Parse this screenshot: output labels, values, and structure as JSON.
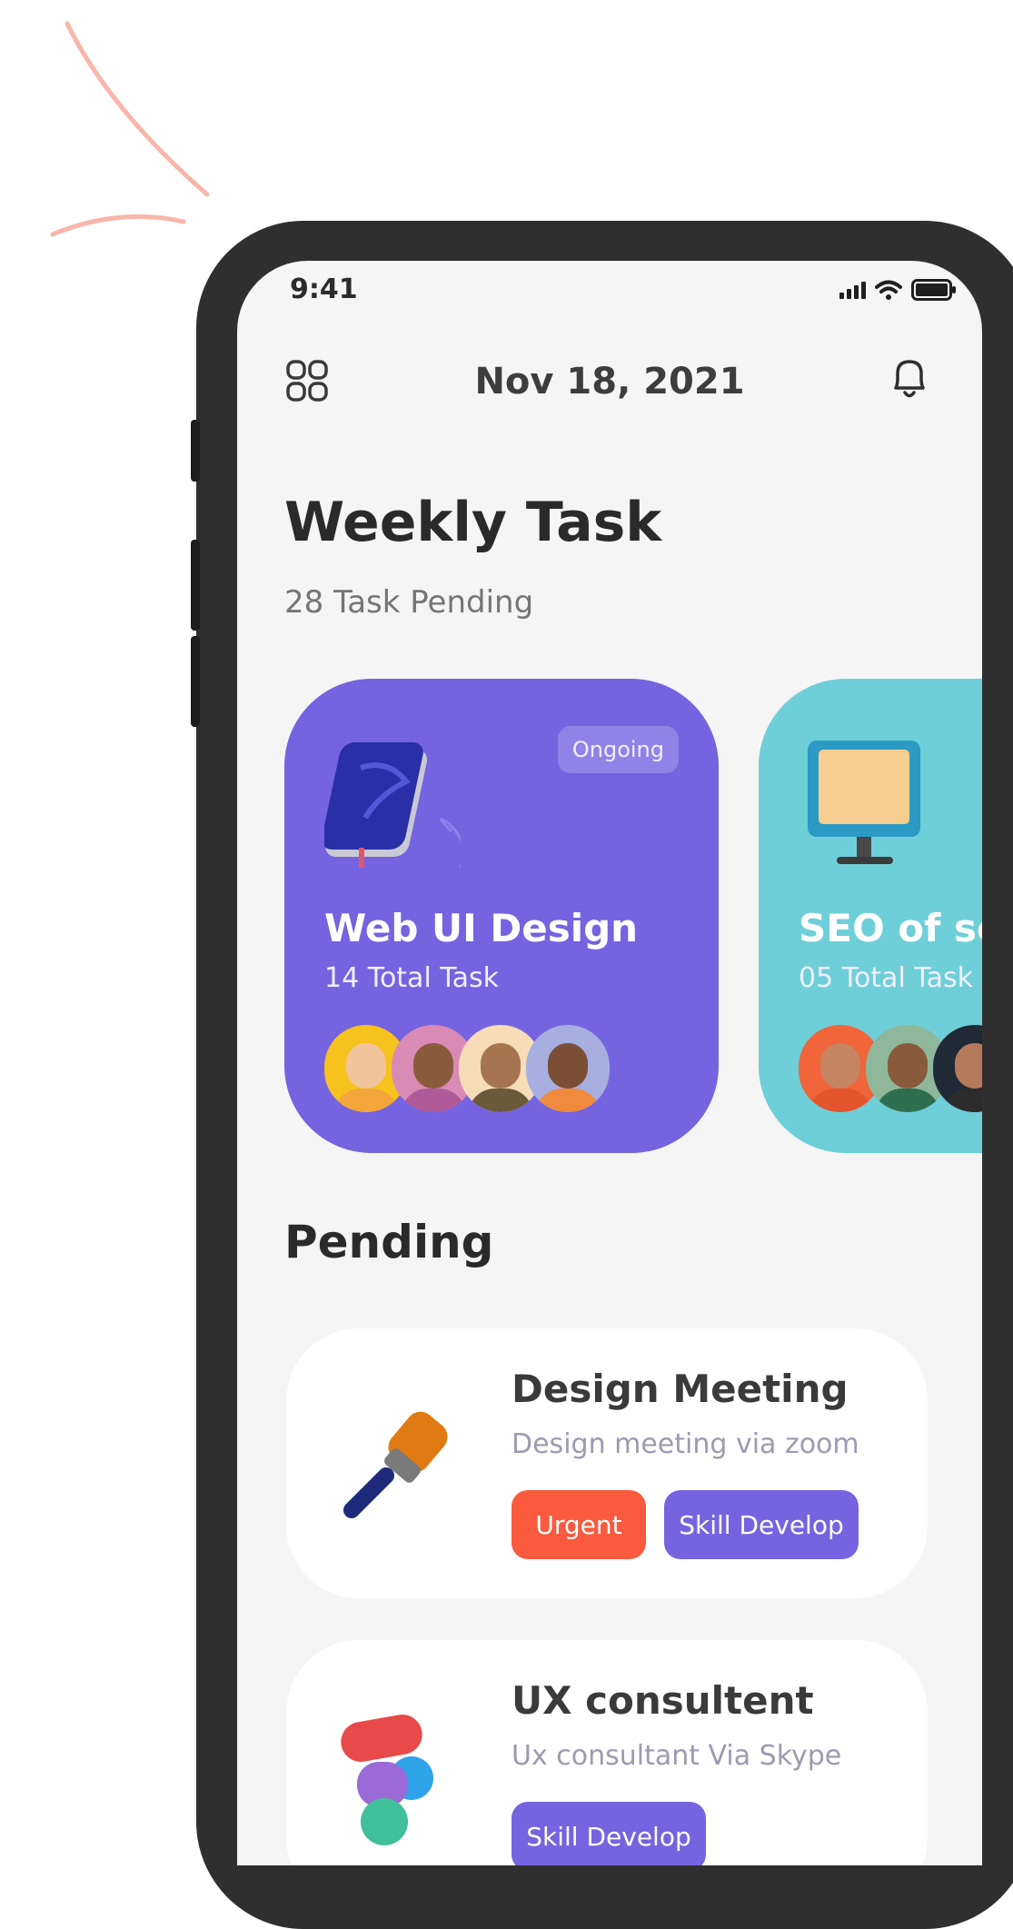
{
  "status_bar": {
    "time": "9:41"
  },
  "header": {
    "date": "Nov 18, 2021"
  },
  "page": {
    "title": "Weekly Task",
    "subtitle": "28 Task Pending"
  },
  "projects": [
    {
      "title": "Web UI Design",
      "subtitle": "14 Total Task",
      "badge": "Ongoing",
      "color": "#7563e0"
    },
    {
      "title": "SEO of ser",
      "subtitle": "05 Total Task",
      "color": "#6fcfd8"
    }
  ],
  "pending": {
    "title": "Pending",
    "tasks": [
      {
        "title": "Design Meeting",
        "subtitle": "Design meeting via zoom",
        "tags": [
          "Urgent",
          "Skill Develop"
        ]
      },
      {
        "title": "UX consultent",
        "subtitle": "Ux consultant Via Skype",
        "tags": [
          "Skill Develop"
        ]
      }
    ]
  },
  "colors": {
    "accent": "#7563e0",
    "urgent": "#fa5a3d",
    "teal": "#6fcfd8",
    "decoration": "#f8b6aa"
  }
}
